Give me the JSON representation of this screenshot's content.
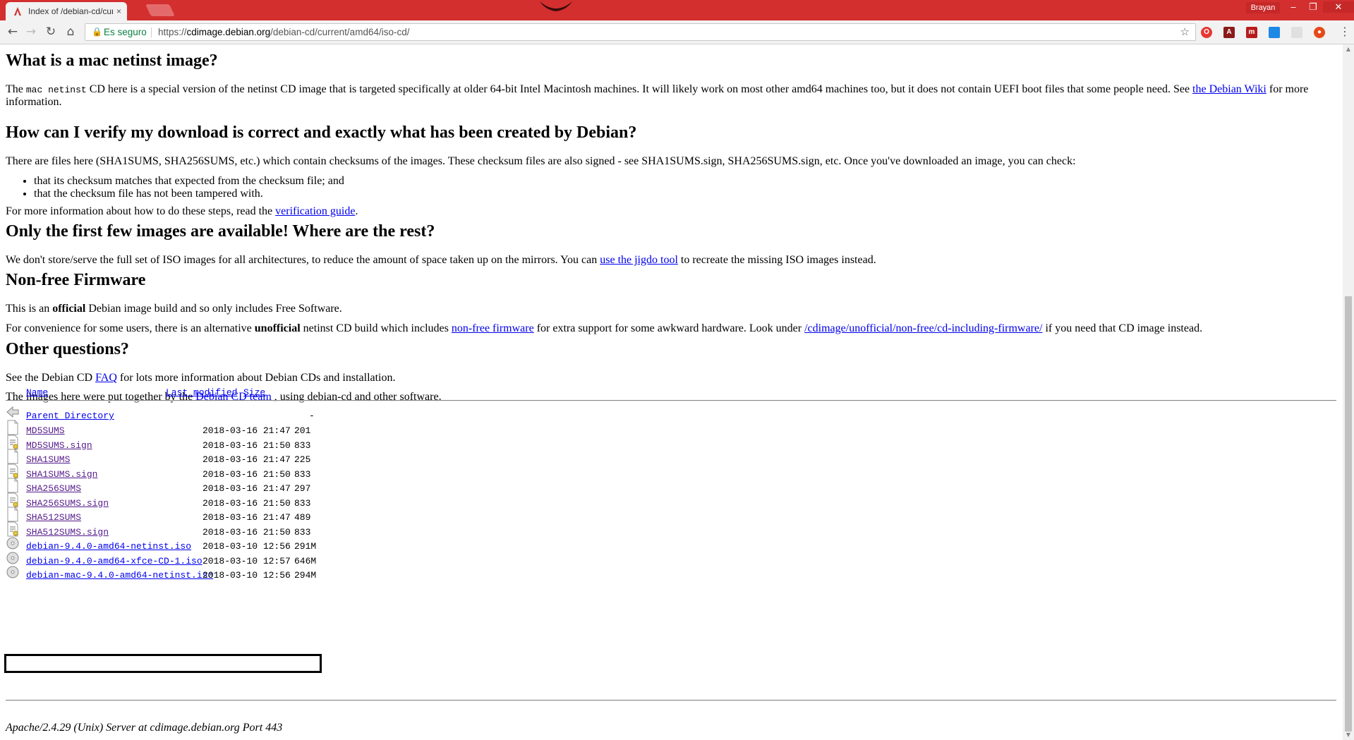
{
  "browser": {
    "tab_title": "Index of /debian-cd/curr",
    "tab_close": "×",
    "user_label": "Brayan",
    "secure_label": "Es seguro",
    "url_prefix": "https://",
    "url_host": "cdimage.debian.org",
    "url_path": "/debian-cd/current/amd64/iso-cd/",
    "colors": {
      "titlebar": "#d32f2f",
      "secure": "#0b8043"
    }
  },
  "content": {
    "h_mac": "What is a mac netinst image?",
    "p_mac": {
      "before": "The ",
      "code": "mac netinst",
      "after": " CD here is a special version of the netinst CD image that is targeted specifically at older 64-bit Intel Macintosh machines. It will likely work on most other amd64 machines too, but it does not contain UEFI boot files that some people need. See ",
      "link": "the Debian Wiki",
      "end": " for more",
      "line2": "information."
    },
    "h_verify": "How can I verify my download is correct and exactly what has been created by Debian?",
    "p_verify": "There are files here (SHA1SUMS, SHA256SUMS, etc.) which contain checksums of the images. These checksum files are also signed - see SHA1SUMS.sign, SHA256SUMS.sign, etc. Once you've downloaded an image, you can check:",
    "bullets": [
      "that its checksum matches that expected from the checksum file; and",
      "that the checksum file has not been tampered with."
    ],
    "p_moreinfo": {
      "before": "For more information about how to do these steps, read the ",
      "link": "verification guide",
      "after": "."
    },
    "h_rest": "Only the first few images are available! Where are the rest?",
    "p_rest": {
      "before": "We don't store/serve the full set of ISO images for all architectures, to reduce the amount of space taken up on the mirrors. You can ",
      "link": "use the jigdo tool",
      "after": " to recreate the missing ISO images instead."
    },
    "h_firmware": "Non-free Firmware",
    "p_official": {
      "before": "This is an ",
      "bold": "official",
      "after": " Debian image build and so only includes Free Software."
    },
    "p_unofficial": {
      "before": "For convenience for some users, there is an alternative ",
      "bold": "unofficial",
      "mid": " netinst CD build which includes ",
      "link1": "non-free firmware",
      "mid2": " for extra support for some awkward hardware. Look under ",
      "link2": "/cdimage/unofficial/non-free/cd-including-firmware/",
      "after": " if you need that CD image instead."
    },
    "h_other": "Other questions?",
    "p_faq": {
      "before": "See the Debian CD ",
      "link": "FAQ",
      "after": " for lots more information about Debian CDs and installation."
    },
    "p_team": {
      "before": "The images here were put together by the ",
      "link": "Debian CD team",
      "after": " , using debian-cd and other software."
    }
  },
  "listing": {
    "headers": {
      "name": "Name",
      "modified": "Last modified",
      "size": "Size"
    },
    "parent": {
      "name": "Parent Directory",
      "size": "-"
    },
    "files": [
      {
        "name": "MD5SUMS",
        "modified": "2018-03-16 21:47",
        "size": "201",
        "icon": "text-file-icon"
      },
      {
        "name": "MD5SUMS.sign",
        "modified": "2018-03-16 21:50",
        "size": "833",
        "icon": "signed-file-icon"
      },
      {
        "name": "SHA1SUMS",
        "modified": "2018-03-16 21:47",
        "size": "225",
        "icon": "text-file-icon"
      },
      {
        "name": "SHA1SUMS.sign",
        "modified": "2018-03-16 21:50",
        "size": "833",
        "icon": "signed-file-icon"
      },
      {
        "name": "SHA256SUMS",
        "modified": "2018-03-16 21:47",
        "size": "297",
        "icon": "text-file-icon"
      },
      {
        "name": "SHA256SUMS.sign",
        "modified": "2018-03-16 21:50",
        "size": "833",
        "icon": "signed-file-icon"
      },
      {
        "name": "SHA512SUMS",
        "modified": "2018-03-16 21:47",
        "size": "489",
        "icon": "text-file-icon"
      },
      {
        "name": "SHA512SUMS.sign",
        "modified": "2018-03-16 21:50",
        "size": "833",
        "icon": "signed-file-icon"
      },
      {
        "name": "debian-9.4.0-amd64-netinst.iso",
        "modified": "2018-03-10 12:56",
        "size": "291M",
        "icon": "cd-icon"
      },
      {
        "name": "debian-9.4.0-amd64-xfce-CD-1.iso",
        "modified": "2018-03-10 12:57",
        "size": "646M",
        "icon": "cd-icon"
      },
      {
        "name": "debian-mac-9.4.0-amd64-netinst.iso",
        "modified": "2018-03-10 12:56",
        "size": "294M",
        "icon": "cd-icon"
      }
    ]
  },
  "footer": {
    "address": "Apache/2.4.29 (Unix) Server at cdimage.debian.org Port 443"
  }
}
